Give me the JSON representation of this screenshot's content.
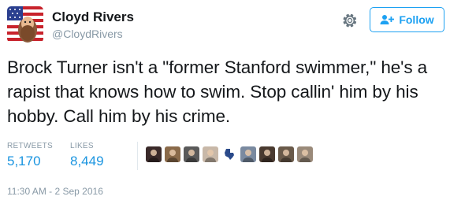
{
  "user": {
    "name": "Cloyd Rivers",
    "handle": "@CloydRivers"
  },
  "follow_button": {
    "label": "Follow",
    "icon": "add-user-icon"
  },
  "settings_icon": "gear-icon",
  "tweet": {
    "text": "Brock Turner isn't a \"former Stanford swimmer,\" he's a rapist that knows how to swim. Stop callin' him by his hobby. Call him by his crime."
  },
  "stats": {
    "retweets_label": "RETWEETS",
    "retweets_count": "5,170",
    "likes_label": "LIKES",
    "likes_count": "8,449"
  },
  "likers": [
    {
      "color": "#3a2a2a",
      "icon": "user-avatar"
    },
    {
      "color": "#8a6a4a",
      "icon": "user-avatar"
    },
    {
      "color": "#5a5a5a",
      "icon": "user-avatar"
    },
    {
      "color": "#c8b8a8",
      "icon": "user-avatar"
    },
    {
      "color": "#3a6ab0",
      "icon": "texas-flag-avatar"
    },
    {
      "color": "#7a8aa0",
      "icon": "user-avatar"
    },
    {
      "color": "#4a3a30",
      "icon": "user-avatar"
    },
    {
      "color": "#6a5a4a",
      "icon": "user-avatar"
    },
    {
      "color": "#9a8a7a",
      "icon": "user-avatar"
    }
  ],
  "timestamp": "11:30 AM - 2 Sep 2016",
  "colors": {
    "accent": "#1da1f2",
    "link": "#1b95e0",
    "muted": "#8899a6",
    "text": "#14171a"
  }
}
